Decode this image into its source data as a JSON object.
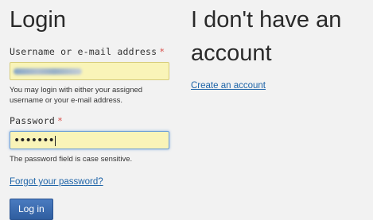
{
  "login": {
    "title": "Login",
    "username": {
      "label": "Username or e-mail address",
      "required_mark": "*",
      "value_obscured": true,
      "help": "You may login with either your assigned username or your e-mail address."
    },
    "password": {
      "label": "Password",
      "required_mark": "*",
      "value": "•••••••",
      "help": "The password field is case sensitive."
    },
    "forgot_link": "Forgot your password?",
    "submit_label": "Log in"
  },
  "register": {
    "title": "I don't have an account",
    "create_link": "Create an account"
  },
  "colors": {
    "background": "#f2f2f2",
    "input_fill": "#f9f4b8",
    "required": "#d9534f",
    "link": "#1e64a8",
    "button": "#3d6db0"
  }
}
